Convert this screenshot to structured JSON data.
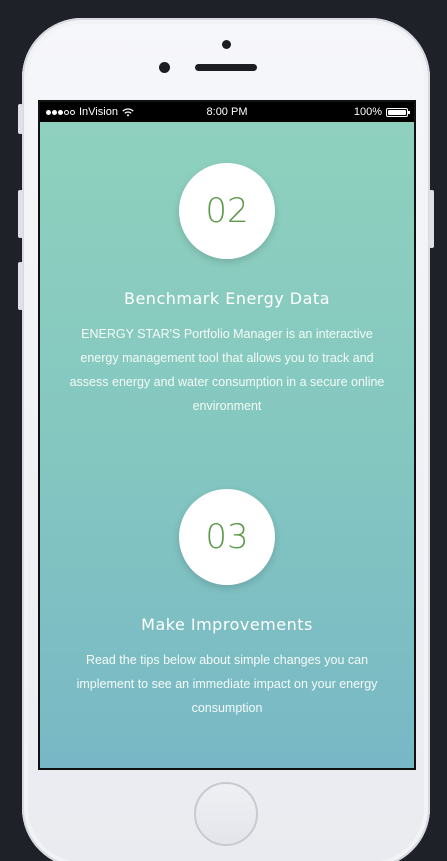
{
  "status_bar": {
    "carrier": "InVision",
    "time": "8:00 PM",
    "battery": "100%"
  },
  "steps": [
    {
      "number": "02",
      "title": "Benchmark Energy Data",
      "description": "ENERGY STAR'S Portfolio Manager is an interactive energy management tool that allows you to track and assess energy and water consumption in a secure online environment"
    },
    {
      "number": "03",
      "title": "Make Improvements",
      "description": "Read the tips below about simple changes you can implement to see an immediate impact on your energy consumption"
    }
  ],
  "colors": {
    "gradient_top": "#8fd1be",
    "gradient_bottom": "#78b8c6",
    "number_color": "#5d9a4a",
    "background": "#1f2129"
  }
}
